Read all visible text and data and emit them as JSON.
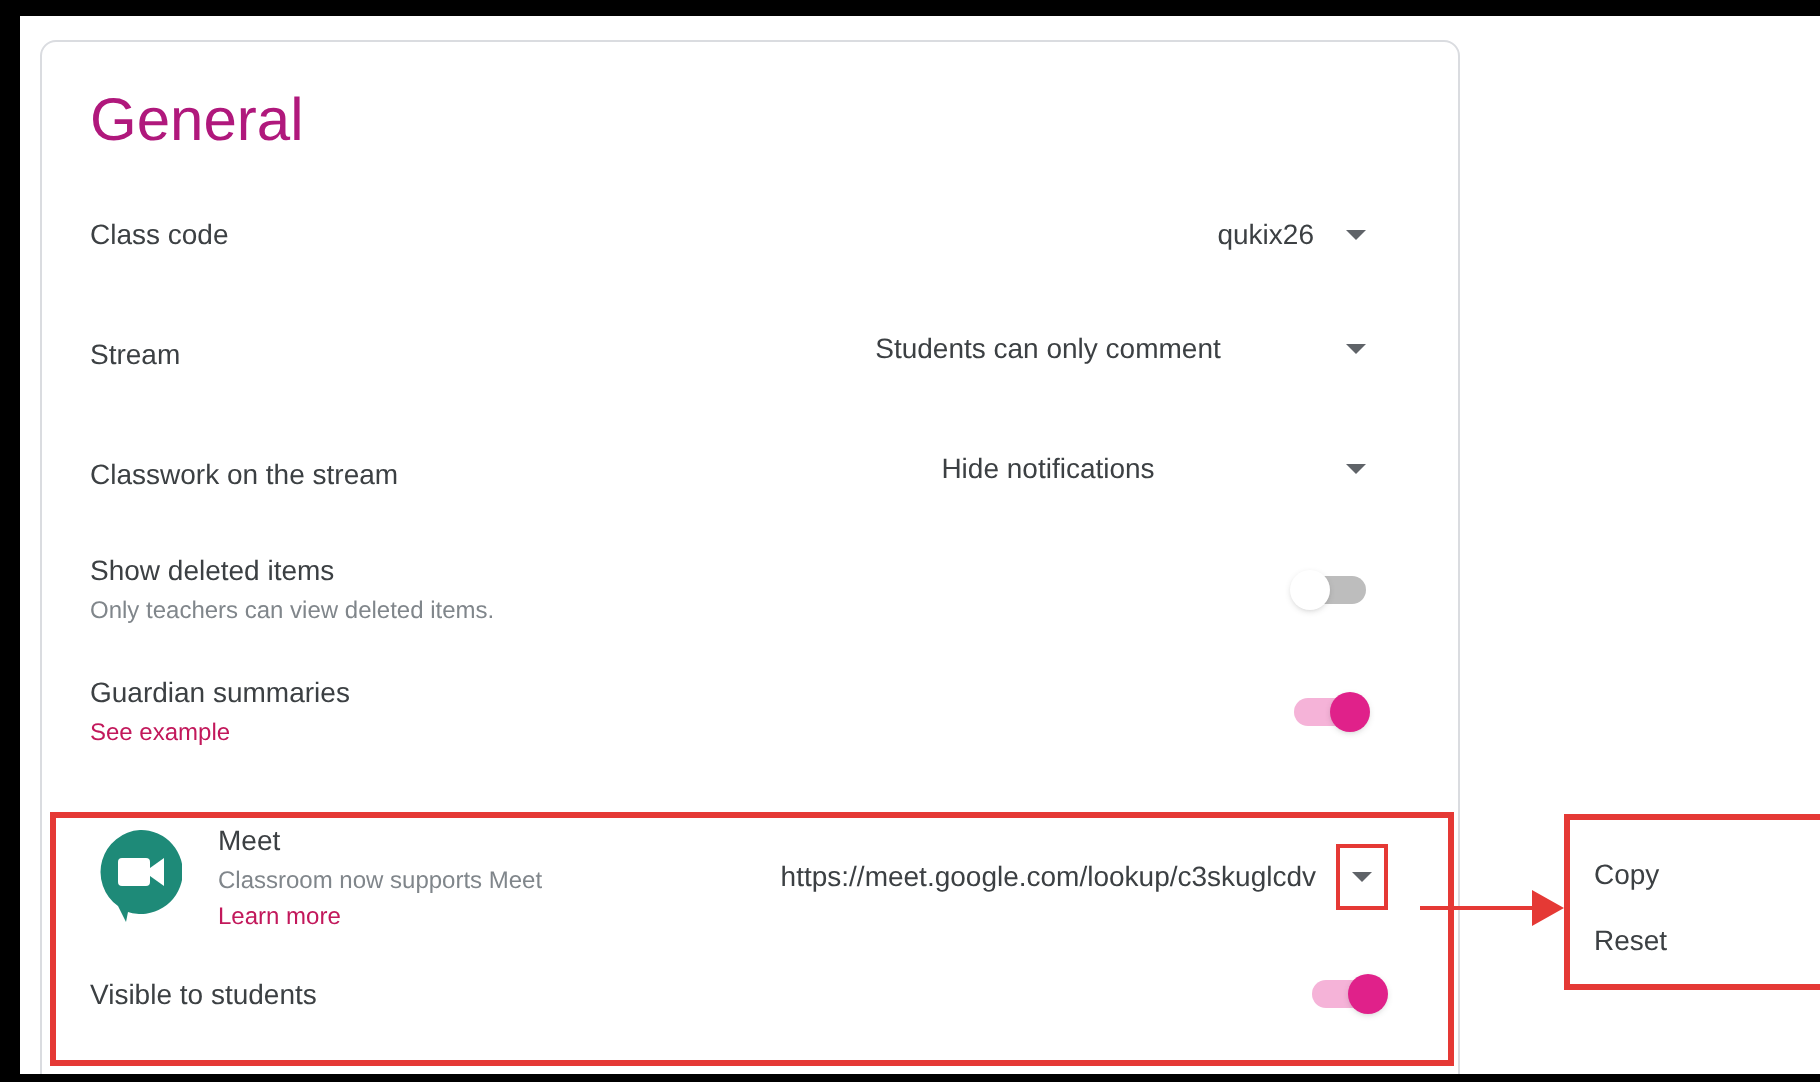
{
  "title": "General",
  "settings": [
    {
      "kind": "code",
      "label": "Class code",
      "value": "qukix26"
    },
    {
      "kind": "dropdown",
      "label": "Stream",
      "value": "Students can only comment"
    },
    {
      "kind": "dropdown",
      "label": "Classwork on the stream",
      "value": "Hide notifications"
    },
    {
      "kind": "toggle",
      "label": "Show deleted items",
      "note": "Only teachers can view deleted items.",
      "on": false
    },
    {
      "kind": "toggle",
      "label": "Guardian summaries",
      "link": "See example",
      "on": true
    }
  ],
  "meet": {
    "title": "Meet",
    "subtitle": "Classroom now supports Meet",
    "link": "Learn more",
    "url": "https://meet.google.com/lookup/c3skuglcdv",
    "visible_label": "Visible to students",
    "visible_on": true
  },
  "menu": [
    "Copy",
    "Reset"
  ]
}
